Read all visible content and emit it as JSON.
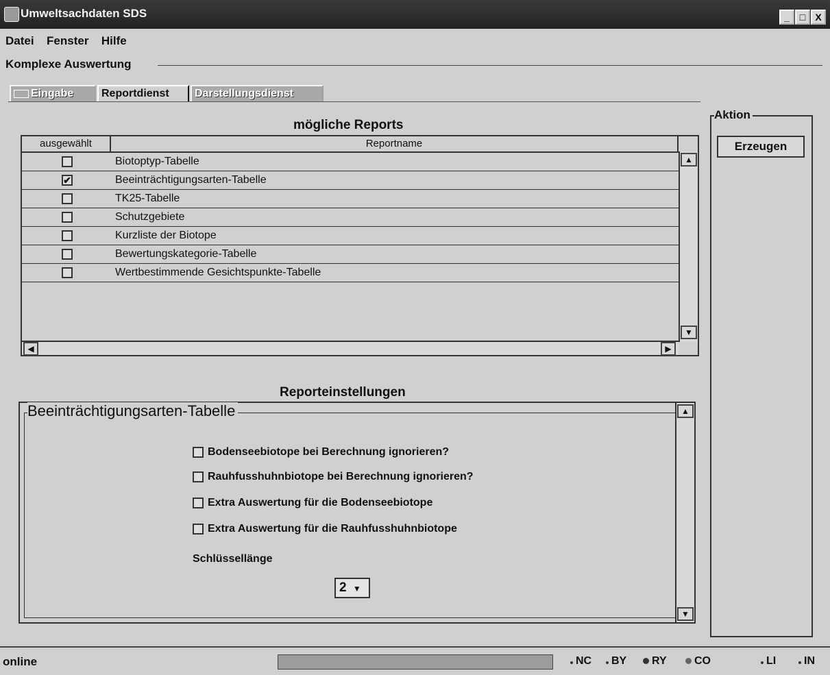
{
  "window": {
    "title": "Umweltsachdaten SDS",
    "controls": [
      "_",
      "□",
      "X"
    ]
  },
  "menu": [
    "Datei",
    "Fenster",
    "Hilfe"
  ],
  "main_group_label": "Komplexe Auswertung",
  "tabs": [
    {
      "label": "Eingabe",
      "active": false
    },
    {
      "label": "Reportdienst",
      "active": true
    },
    {
      "label": "Darstellungsdienst",
      "active": false
    }
  ],
  "reports": {
    "title": "mögliche Reports",
    "columns": [
      "ausgewählt",
      "Reportname"
    ],
    "rows": [
      {
        "checked": false,
        "name": "Biotoptyp-Tabelle"
      },
      {
        "checked": true,
        "name": "Beeinträchtigungsarten-Tabelle"
      },
      {
        "checked": false,
        "name": "TK25-Tabelle"
      },
      {
        "checked": false,
        "name": "Schutzgebiete"
      },
      {
        "checked": false,
        "name": "Kurzliste der Biotope"
      },
      {
        "checked": false,
        "name": "Bewertungskategorie-Tabelle"
      },
      {
        "checked": false,
        "name": "Wertbestimmende Gesichtspunkte-Tabelle"
      }
    ],
    "check_mark": "✔"
  },
  "settings": {
    "title": "Reporteinstellungen",
    "group_title": "Beeinträchtigungsarten-Tabelle",
    "options": [
      "Bodenseebiotope bei Berechnung ignorieren?",
      "Rauhfusshuhnbiotope bei Berechnung ignorieren?",
      "Extra Auswertung für die Bodenseebiotope",
      "Extra Auswertung für die Rauhfusshuhnbiotope"
    ],
    "key_length_label": "Schlüssellänge",
    "key_length_value": "2"
  },
  "action": {
    "label": "Aktion",
    "button": "Erzeugen"
  },
  "status": {
    "text": "online",
    "indicators": [
      "NC",
      "BY",
      "RY",
      "CO",
      "LI",
      "IN"
    ]
  }
}
